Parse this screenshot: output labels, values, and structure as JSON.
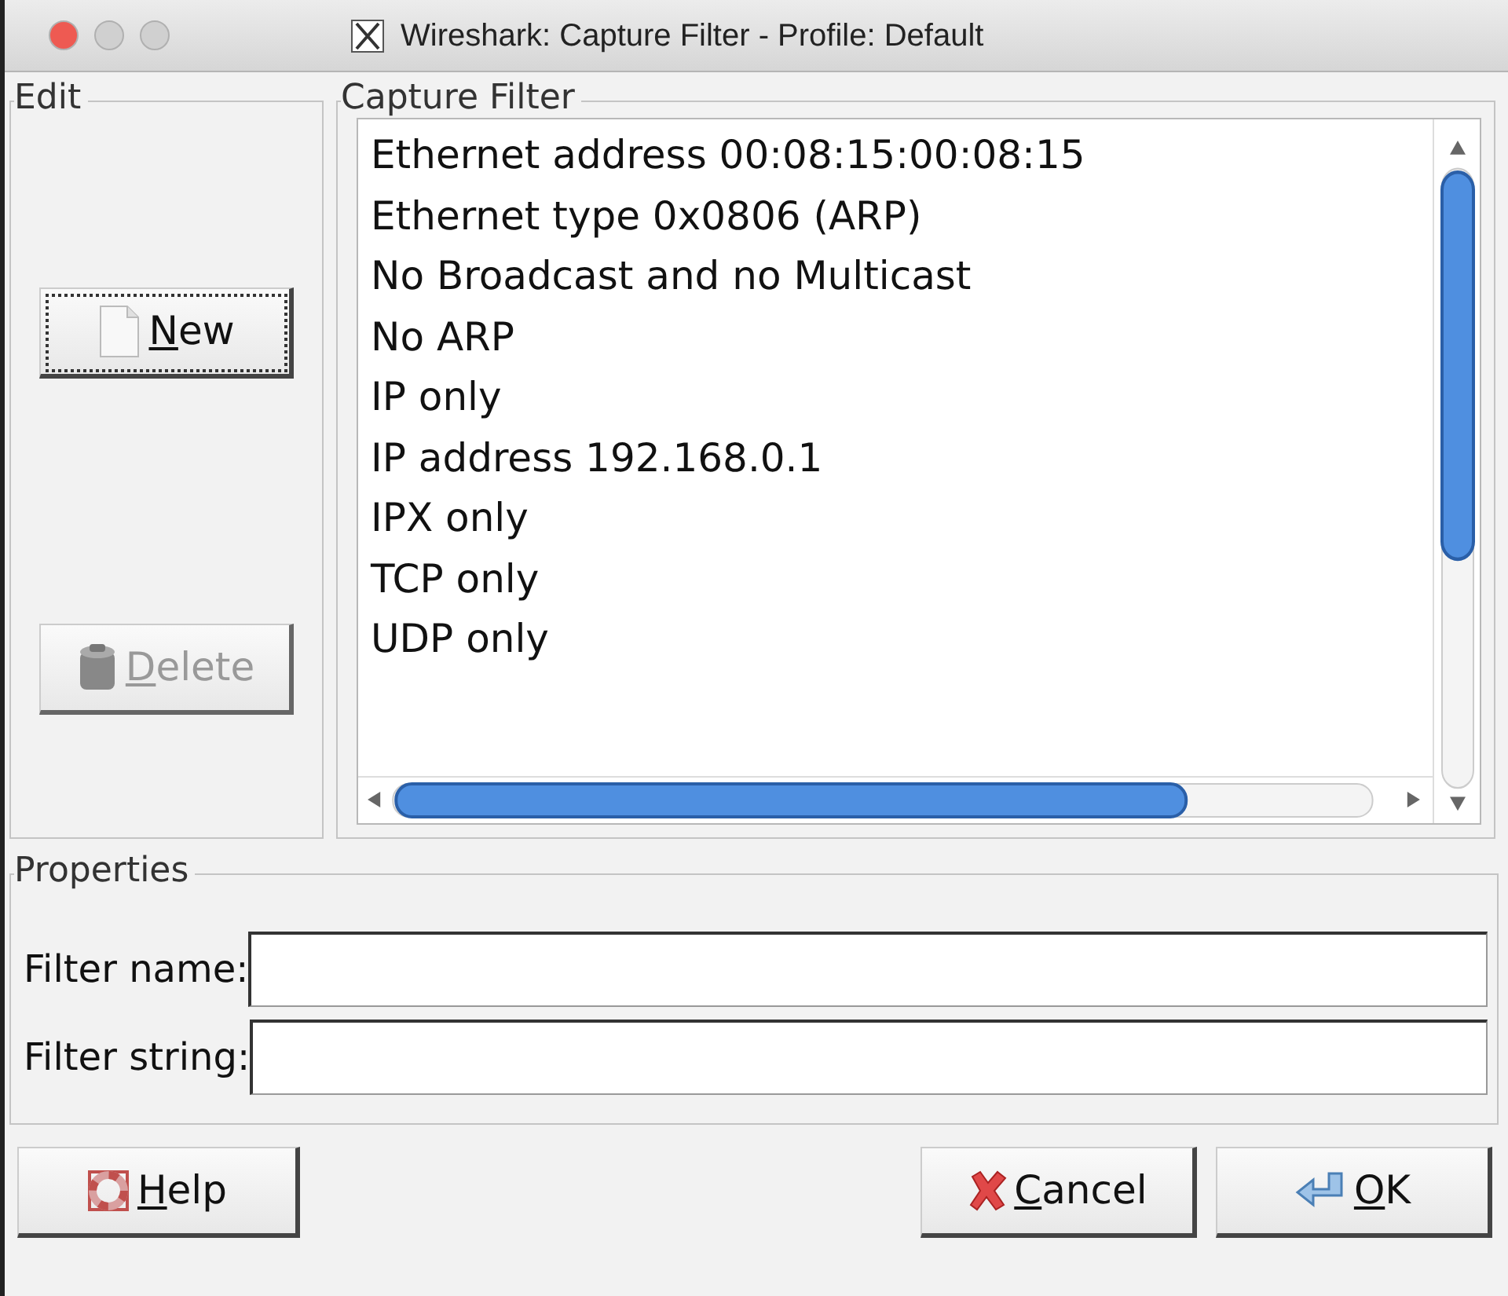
{
  "window": {
    "title": "Wireshark: Capture Filter - Profile: Default"
  },
  "edit": {
    "legend": "Edit",
    "buttons": [
      {
        "label": "New",
        "kind": "new",
        "disabled": false,
        "focused": true
      },
      {
        "label": "Delete",
        "kind": "delete",
        "disabled": true,
        "focused": false
      }
    ]
  },
  "capture_filter": {
    "legend": "Capture Filter",
    "items": [
      {
        "label": "Ethernet address 00:08:15:00:08:15",
        "selected": false
      },
      {
        "label": "Ethernet type 0x0806 (ARP)",
        "selected": false
      },
      {
        "label": "No Broadcast and no Multicast",
        "selected": false
      },
      {
        "label": "No ARP",
        "selected": false
      },
      {
        "label": "IP only",
        "selected": false
      },
      {
        "label": "IP address 192.168.0.1",
        "selected": false
      },
      {
        "label": "IPX only",
        "selected": false
      },
      {
        "label": "TCP only",
        "selected": false
      },
      {
        "label": "UDP only",
        "selected": false
      }
    ]
  },
  "properties": {
    "legend": "Properties",
    "fields": [
      {
        "label": "Filter name:"
      },
      {
        "label": "Filter string:"
      }
    ]
  },
  "buttons": [
    {
      "label": "Help",
      "kind": "help"
    },
    {
      "label": "Cancel",
      "kind": "cancel"
    },
    {
      "label": "OK",
      "kind": "ok"
    }
  ]
}
